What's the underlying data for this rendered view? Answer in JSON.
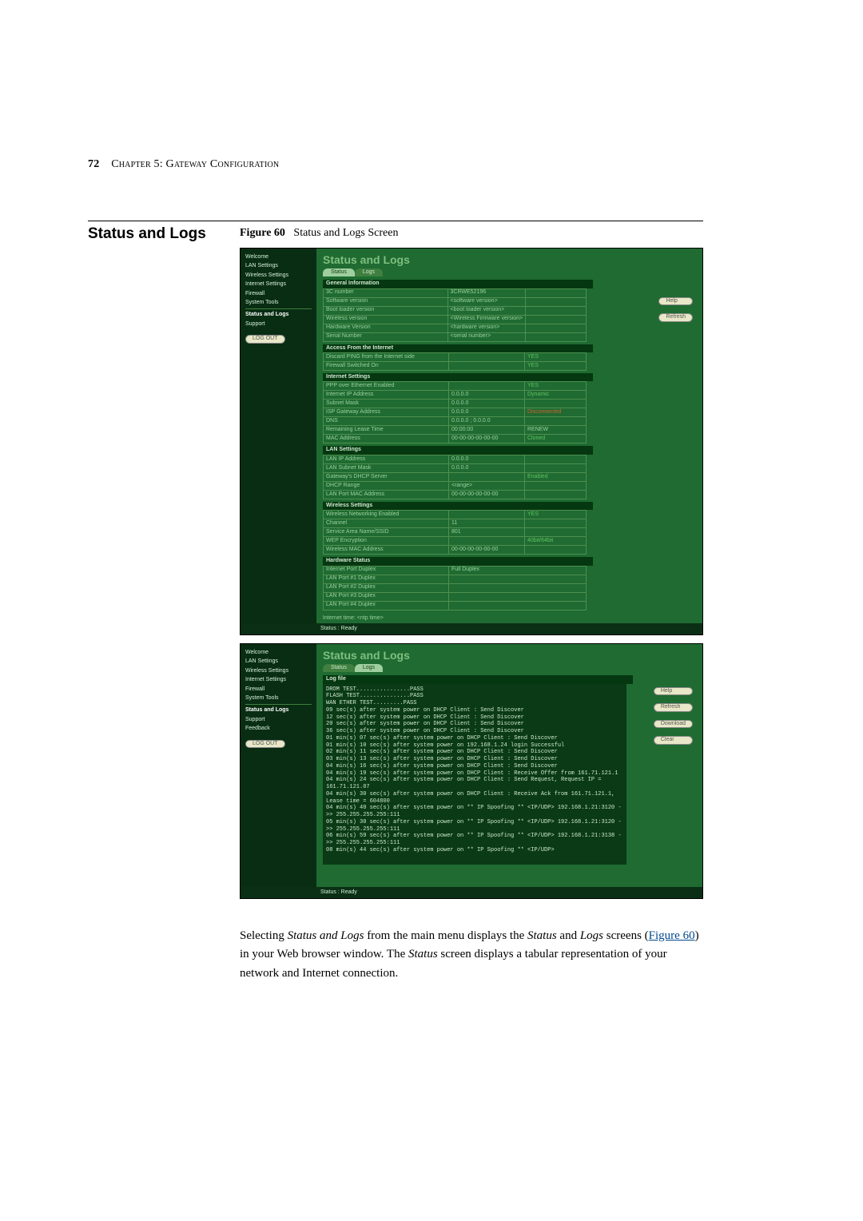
{
  "page": {
    "number": "72",
    "chapter_label": "Chapter 5: Gateway Configuration"
  },
  "section": {
    "title": "Status and Logs",
    "figure_label": "Figure 60",
    "figure_title": "Status and Logs Screen"
  },
  "router_common": {
    "title": "Status and Logs",
    "tab_status": "Status",
    "tab_logs": "Logs",
    "sidebar": {
      "welcome": "Welcome",
      "lan": "LAN Settings",
      "wireless": "Wireless Settings",
      "internet": "Internet Settings",
      "firewall": "Firewall",
      "tools": "System Tools",
      "status_logs": "Status and Logs",
      "support": "Support",
      "feedback": "Feedback",
      "logout": "LOG OUT"
    },
    "buttons": {
      "help": "Help",
      "refresh": "Refresh",
      "download": "Download",
      "clear": "Clear",
      "renew": "RENEW"
    },
    "status_ready": "Status : Ready"
  },
  "status_screen": {
    "general": {
      "header": "General Information",
      "rows": [
        [
          "3C number",
          "3CRWE52196",
          ""
        ],
        [
          "Software version",
          "<software version>",
          ""
        ],
        [
          "Boot loader version",
          "<boot loader version>",
          ""
        ],
        [
          "Wireless version",
          "<Wireless Firmware version>",
          ""
        ],
        [
          "Hardware Version",
          "<hardware version>",
          ""
        ],
        [
          "Serial Number",
          "<serial number>",
          ""
        ]
      ]
    },
    "access": {
      "header": "Access From the Internet",
      "rows": [
        [
          "Discard PING from the Internet side",
          "",
          "YES"
        ],
        [
          "Firewall Switched On",
          "",
          "YES"
        ]
      ]
    },
    "internet": {
      "header": "Internet Settings",
      "rows": [
        [
          "PPP over Ethernet Enabled",
          "",
          "YES"
        ],
        [
          "Internet IP Address",
          "0.0.0.0",
          "Dynamic"
        ],
        [
          "Subnet Mask",
          "0.0.0.0",
          ""
        ],
        [
          "ISP Gateway Address",
          "0.0.0.0",
          "Disconnected"
        ],
        [
          "DNS",
          "0.0.0.0 ; 0.0.0.0",
          ""
        ],
        [
          "Remaining Lease Time",
          "00:00:00",
          "RENEW"
        ],
        [
          "MAC Address",
          "00-00-00-00-00-00",
          "Cloned"
        ]
      ]
    },
    "lan": {
      "header": "LAN Settings",
      "rows": [
        [
          "LAN IP Address",
          "0.0.0.0",
          ""
        ],
        [
          "LAN Subnet Mask",
          "0.0.0.0",
          ""
        ],
        [
          "Gateway's DHCP Server",
          "",
          "Enabled"
        ],
        [
          "DHCP Range",
          "<range>",
          ""
        ],
        [
          "LAN Port MAC Address",
          "00-00-00-00-00-00",
          ""
        ]
      ]
    },
    "wireless": {
      "header": "Wireless Settings",
      "rows": [
        [
          "Wireless Networking Enabled",
          "",
          "YES"
        ],
        [
          "Channel",
          "11",
          ""
        ],
        [
          "Service Area Name/SSID",
          "801",
          ""
        ],
        [
          "WEP Encryption",
          "",
          "40bit/64bit"
        ],
        [
          "Wireless MAC Address",
          "00-00-00-00-00-00",
          ""
        ]
      ]
    },
    "hardware": {
      "header": "Hardware Status",
      "rows": [
        [
          "Internet Port Duplex",
          "Full Duplex"
        ],
        [
          "LAN Port #1 Duplex",
          ""
        ],
        [
          "LAN Port #2 Duplex",
          ""
        ],
        [
          "LAN Port #3 Duplex",
          ""
        ],
        [
          "LAN Port #4 Duplex",
          ""
        ]
      ]
    },
    "footer_line": "Internet time:    <ntp time>"
  },
  "logs_screen": {
    "header": "Log file",
    "content": "DROM TEST................PASS\nFLASH TEST...............PASS\nWAN ETHER TEST.........PASS\n09 sec(s) after system power on DHCP Client : Send Discover\n12 sec(s) after system power on DHCP Client : Send Discover\n20 sec(s) after system power on DHCP Client : Send Discover\n36 sec(s) after system power on DHCP Client : Send Discover\n01 min(s) 07 sec(s) after system power on DHCP Client : Send Discover\n01 min(s) 10 sec(s) after system power on 192.168.1.24 login Successful\n02 min(s) 11 sec(s) after system power on DHCP Client : Send Discover\n03 min(s) 13 sec(s) after system power on DHCP Client : Send Discover\n04 min(s) 16 sec(s) after system power on DHCP Client : Send Discover\n04 min(s) 19 sec(s) after system power on DHCP Client : Receive Offer from 161.71.121.1\n04 min(s) 24 sec(s) after system power on DHCP Client : Send Request, Request IP = 161.71.121.07\n04 min(s) 30 sec(s) after system power on DHCP Client : Receive Ack from 161.71.121.1, Lease time = 604800\n04 min(s) 40 sec(s) after system power on ** IP Spoofing ** <IP/UDP> 192.168.1.21:3120 ->> 255.255.255.255:111\n05 min(s) 30 sec(s) after system power on ** IP Spoofing ** <IP/UDP> 192.168.1.21:3120 ->> 255.255.255.255:111\n06 min(s) 59 sec(s) after system power on ** IP Spoofing ** <IP/UDP> 192.168.1.21:3138 ->> 255.255.255.255:111\n08 min(s) 44 sec(s) after system power on ** IP Spoofing ** <IP/UDP>"
  },
  "body": {
    "text_prefix": "Selecting ",
    "italic1": "Status and Logs",
    "mid1": " from the main menu displays the ",
    "italic2": "Status",
    "mid2": " and ",
    "italic3": "Logs",
    "mid3": " screens (",
    "link_text": "Figure 60",
    "mid4": ") in your Web browser window. The ",
    "italic4": "Status",
    "tail": " screen displays a tabular representation of your network and Internet connection."
  }
}
